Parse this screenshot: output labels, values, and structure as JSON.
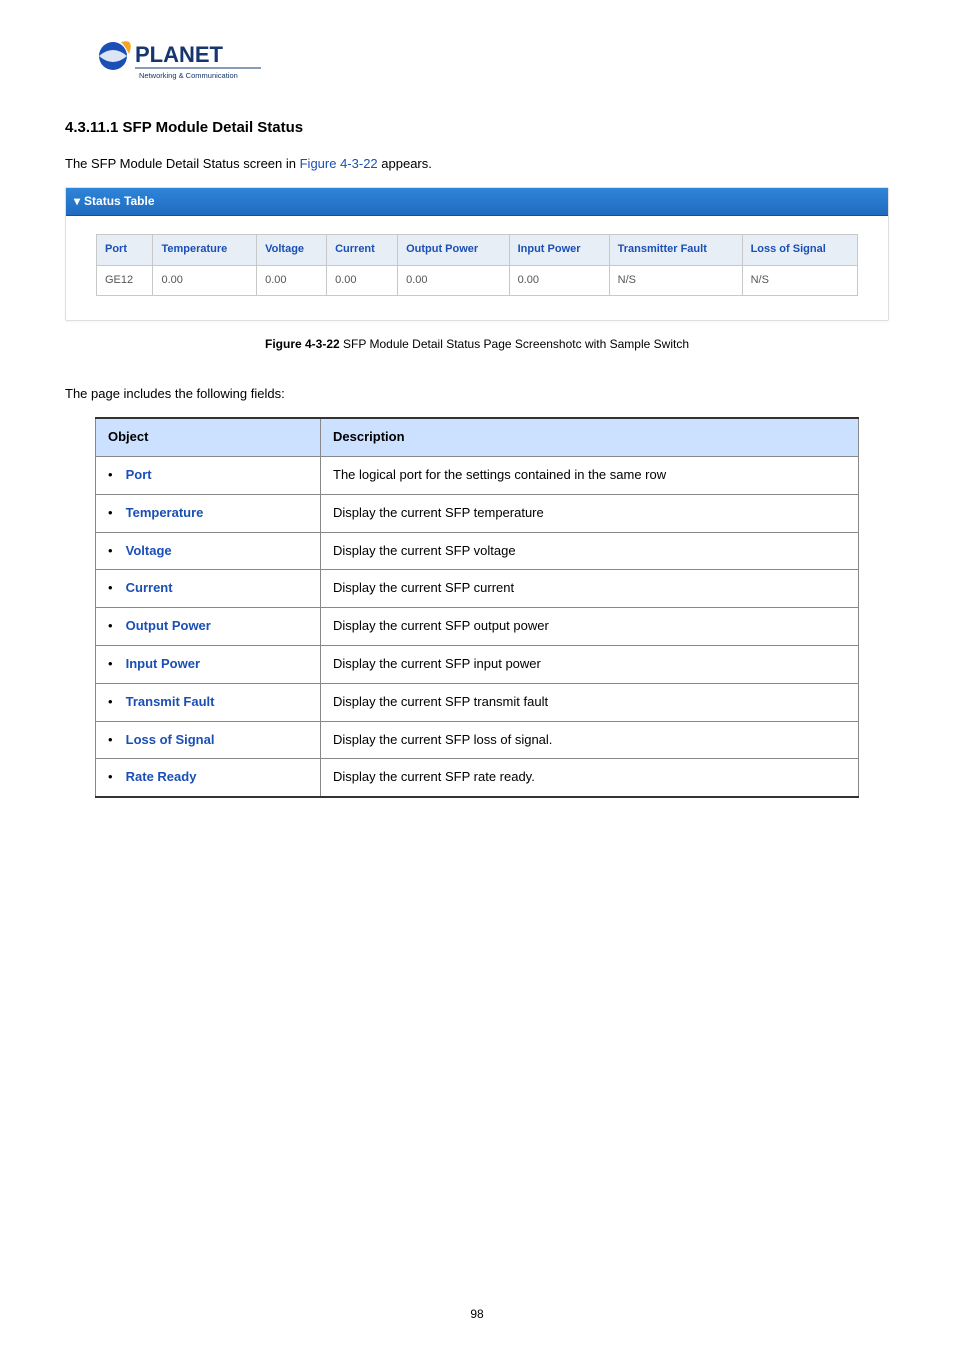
{
  "logo": {
    "brand_top": "PLANET",
    "brand_sub": "Networking & Communication"
  },
  "heading": "4.3.11.1 SFP Module Detail Status",
  "intro_before": "The SFP Module Detail Status screen in ",
  "intro_link": "Figure 4-3-22",
  "intro_after": " appears.",
  "panel_title": "Status Table",
  "status_headers": [
    "Port",
    "Temperature",
    "Voltage",
    "Current",
    "Output Power",
    "Input Power",
    "Transmitter Fault",
    "Loss of Signal"
  ],
  "status_row": [
    "GE12",
    "0.00",
    "0.00",
    "0.00",
    "0.00",
    "0.00",
    "N/S",
    "N/S"
  ],
  "figure_label": "Figure 4-3-22",
  "figure_caption": " SFP Module Detail Status Page Screenshotc with Sample Switch",
  "fields_intro": "The page includes the following fields:",
  "desc_headers": {
    "object": "Object",
    "description": "Description"
  },
  "desc_rows": [
    {
      "object": "Port",
      "description": "The logical port for the settings contained in the same row"
    },
    {
      "object": "Temperature",
      "description": "Display the current SFP temperature"
    },
    {
      "object": "Voltage",
      "description": "Display the current SFP voltage"
    },
    {
      "object": "Current",
      "description": "Display the current SFP current"
    },
    {
      "object": "Output Power",
      "description": "Display the current SFP output power"
    },
    {
      "object": "Input Power",
      "description": "Display the current SFP input power"
    },
    {
      "object": "Transmit Fault",
      "description": "Display the current SFP transmit fault"
    },
    {
      "object": "Loss of Signal",
      "description": "Display the current SFP loss of signal."
    },
    {
      "object": "Rate Ready",
      "description": "Display the current SFP rate ready."
    }
  ],
  "page_number": "98"
}
